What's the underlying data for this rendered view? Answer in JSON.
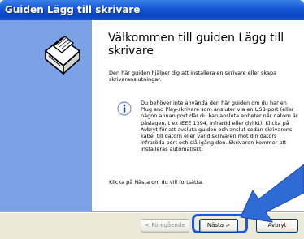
{
  "window": {
    "title": "Guiden Lägg till skrivare"
  },
  "wizard": {
    "heading": "Välkommen till guiden Lägg till skrivare",
    "intro": "Den här guiden hjälper dig att installera en skrivare eller skapa skrivaranslutningar.",
    "info": "Du behöver inte använda den här guiden om du har en Plug and Play-skrivare som ansluter via en USB-port (eller någon annan port där du kan ansluta enheter när datorn är påslagen, t ex IEEE 1394, infraröd eller dylikt). Klicka på Avbryt för att avsluta guiden och anslut sedan skrivarens kabel till datorn eller vänd skrivaren mot din dators infraröda port och slå igång den. Skrivaren kommer att installeras automatiskt.",
    "outro": "Klicka på Nästa om du vill fortsätta."
  },
  "buttons": {
    "back": "< Föregående",
    "next": "Nästa >",
    "cancel": "Avbryt"
  },
  "icons": {
    "printer": "printer-icon",
    "info": "info-icon",
    "pointer": "arrow-pointer"
  },
  "colors": {
    "titlebar": "#0a44c2",
    "side_panel": "#7ba2e7",
    "highlight": "#1a5ad9"
  }
}
